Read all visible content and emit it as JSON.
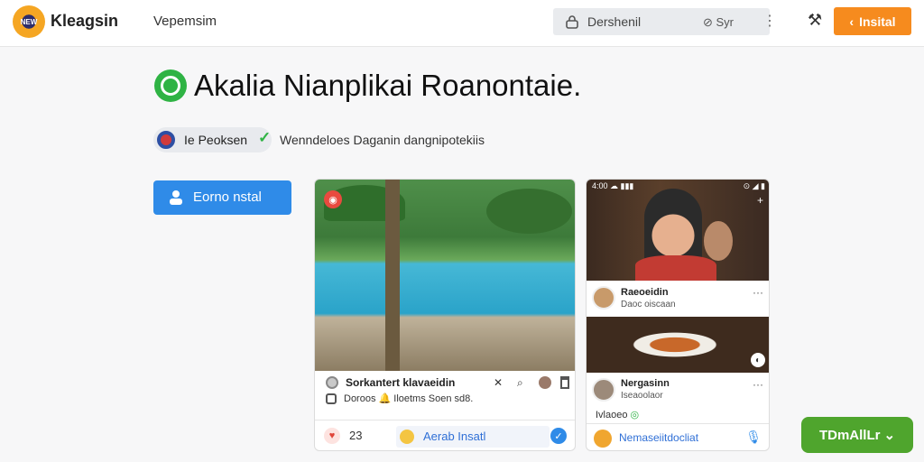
{
  "header": {
    "logo_text": "NEW",
    "brand": "Kleagsin",
    "nav_link": "Vepemsim",
    "search_text": "Dershenil",
    "search_hint": "Syr",
    "install_label": "Insital"
  },
  "hero": {
    "title": "Akalia Nianplikai Roanontaie.",
    "pill_label": "Ie Peoksen",
    "subtitle": "Wenndeloes Daganin dangnipotekiis",
    "install_button": "Eorno nstal"
  },
  "card1": {
    "caption_title": "Sorkantert klavaeidin",
    "caption_sub": "Doroos  🔔  Iloetms Soen sd8.",
    "count": "23",
    "chip_label": "Aerab Insatl"
  },
  "card2": {
    "status_left": "4:00 ☁ ▮▮▮",
    "status_right": "⊙ ◢ ▮",
    "post1_name": "Raeoeidin",
    "post1_sub": "Daoc oiscaan",
    "post2_name": "Nergasinn",
    "post2_sub": "Iseaoolaor",
    "caption": "Ivlaoeo",
    "bottom_label": "Nemaseiitdocliat"
  },
  "fab": {
    "label": "TDmAllLr"
  },
  "colors": {
    "accent_orange": "#f68b1e",
    "accent_blue": "#2f8be8",
    "accent_green": "#4fa52d"
  }
}
